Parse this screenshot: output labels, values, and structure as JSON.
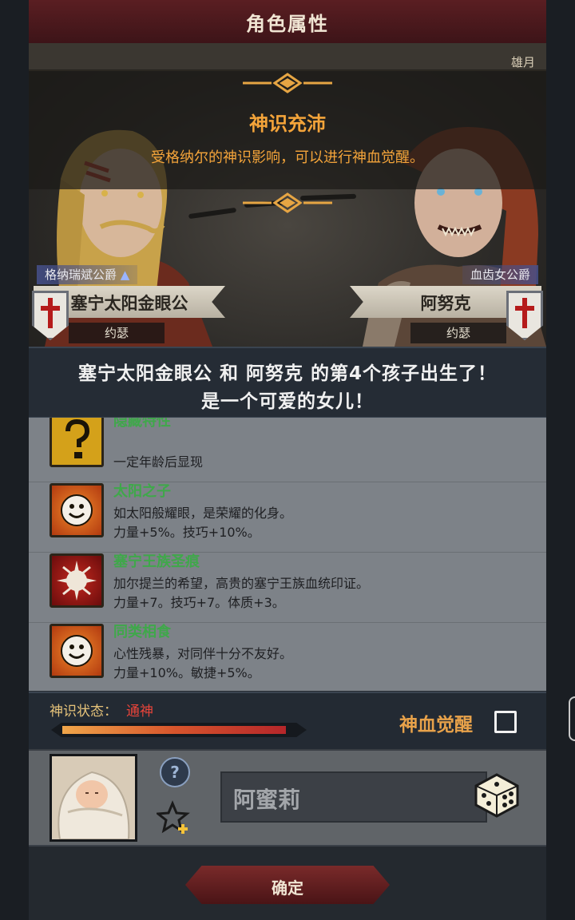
{
  "header": {
    "title": "角色属性"
  },
  "scene": {
    "corner_text": "雄月"
  },
  "banner": {
    "title": "神识充沛",
    "subtitle": "受格纳尔的神识影响，可以进行神血觉醒。"
  },
  "parents": {
    "left": {
      "title": "格纳瑞斌公爵",
      "name": "塞宁太阳金眼公",
      "religion": "约瑟"
    },
    "right": {
      "title": "血齿女公爵",
      "name": "阿努克",
      "religion": "约瑟"
    }
  },
  "announcement": {
    "line1": "塞宁太阳金眼公 和 阿努克 的第4个孩子出生了！",
    "line2": "是一个可爱的女儿！"
  },
  "traits": [
    {
      "icon": "question-mark-icon",
      "name": "隐藏特性",
      "desc1": "",
      "desc2": "一定年龄后显现"
    },
    {
      "icon": "smiling-sun-icon",
      "name": "太阳之子",
      "desc1": "如太阳般耀眼，是荣耀的化身。",
      "desc2": "力量+5%。技巧+10%。"
    },
    {
      "icon": "royal-seal-icon",
      "name": "塞宁王族圣痕",
      "desc1": "加尔提兰的希望，高贵的塞宁王族血统印证。",
      "desc2": "力量+7。技巧+7。体质+3。"
    },
    {
      "icon": "smiling-sun-icon",
      "name": "同类相食",
      "desc1": "心性残暴，对同伴十分不友好。",
      "desc2": "力量+10%。敏捷+5%。"
    }
  ],
  "status": {
    "label": "神识状态：",
    "value": "通神",
    "progress": 0.96,
    "awaken_label": "神血觉醒",
    "awaken_checked": false
  },
  "child": {
    "help_glyph": "?",
    "name_value": "阿蜜莉"
  },
  "footer": {
    "confirm_label": "确定"
  },
  "colors": {
    "accent_orange": "#f4a43a",
    "trait_name_green": "#3fa84a",
    "status_red": "#e8443a",
    "title_bar": "#5a1e22"
  }
}
